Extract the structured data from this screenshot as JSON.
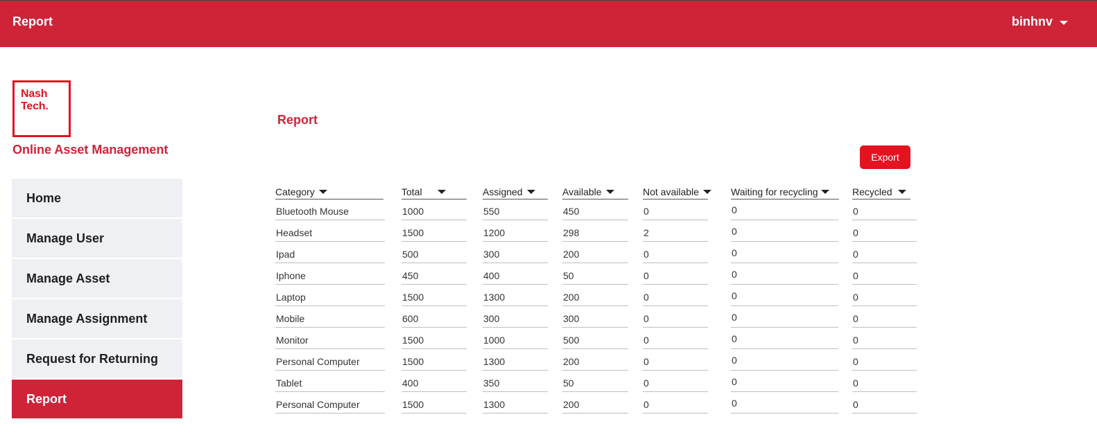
{
  "header": {
    "title": "Report",
    "username": "binhnv"
  },
  "brand": {
    "logo_line1": "Nash",
    "logo_line2": "Tech.",
    "app_name": "Online Asset Management"
  },
  "sidebar": {
    "items": [
      {
        "label": "Home",
        "active": false
      },
      {
        "label": "Manage User",
        "active": false
      },
      {
        "label": "Manage Asset",
        "active": false
      },
      {
        "label": "Manage Assignment",
        "active": false
      },
      {
        "label": "Request for Returning",
        "active": false
      },
      {
        "label": "Report",
        "active": true
      }
    ]
  },
  "main": {
    "title": "Report",
    "export_label": "Export",
    "columns": [
      "Category",
      "Total",
      "Assigned",
      "Available",
      "Not available",
      "Waiting for recycling",
      "Recycled"
    ],
    "rows": [
      [
        "Bluetooth Mouse",
        "1000",
        "550",
        "450",
        "0",
        "0",
        "0"
      ],
      [
        "Headset",
        "1500",
        "1200",
        "298",
        "2",
        "0",
        "0"
      ],
      [
        "Ipad",
        "500",
        "300",
        "200",
        "0",
        "0",
        "0"
      ],
      [
        "Iphone",
        "450",
        "400",
        "50",
        "0",
        "0",
        "0"
      ],
      [
        "Laptop",
        "1500",
        "1300",
        "200",
        "0",
        "0",
        "0"
      ],
      [
        "Mobile",
        "600",
        "300",
        "300",
        "0",
        "0",
        "0"
      ],
      [
        "Monitor",
        "1500",
        "1000",
        "500",
        "0",
        "0",
        "0"
      ],
      [
        "Personal Computer",
        "1500",
        "1300",
        "200",
        "0",
        "0",
        "0"
      ],
      [
        "Tablet",
        "400",
        "350",
        "50",
        "0",
        "0",
        "0"
      ],
      [
        "Personal Computer",
        "1500",
        "1300",
        "200",
        "0",
        "0",
        "0"
      ]
    ]
  },
  "colors": {
    "brand_red": "#cf2338",
    "logo_red": "#e0141f",
    "nav_bg": "#eff0f4"
  }
}
